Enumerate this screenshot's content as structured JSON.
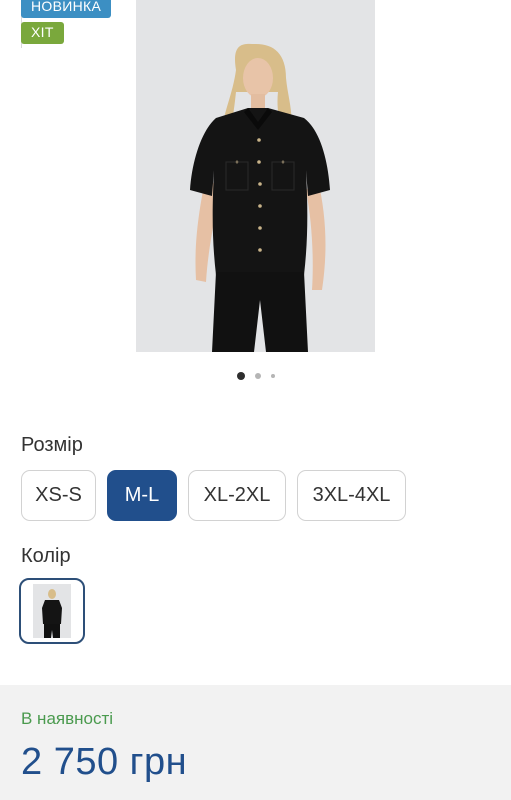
{
  "badges": {
    "new": "НОВИНКА",
    "hit": "ХІТ"
  },
  "product_image": {
    "description_icon": "product-photo",
    "slide_count": 3,
    "active_slide": 1
  },
  "size_section": {
    "label": "Розмір",
    "options": [
      "XS-S",
      "M-L",
      "XL-2XL",
      "3XL-4XL"
    ],
    "selected": "M-L"
  },
  "color_section": {
    "label": "Колір",
    "selected_swatch": "black"
  },
  "purchase": {
    "availability": "В наявності",
    "price": "2 750 грн"
  },
  "colors": {
    "accent": "#214f8c",
    "in_stock": "#4a9a4e",
    "badge_new": "#3c8fc3",
    "badge_hit": "#7aa83c"
  }
}
